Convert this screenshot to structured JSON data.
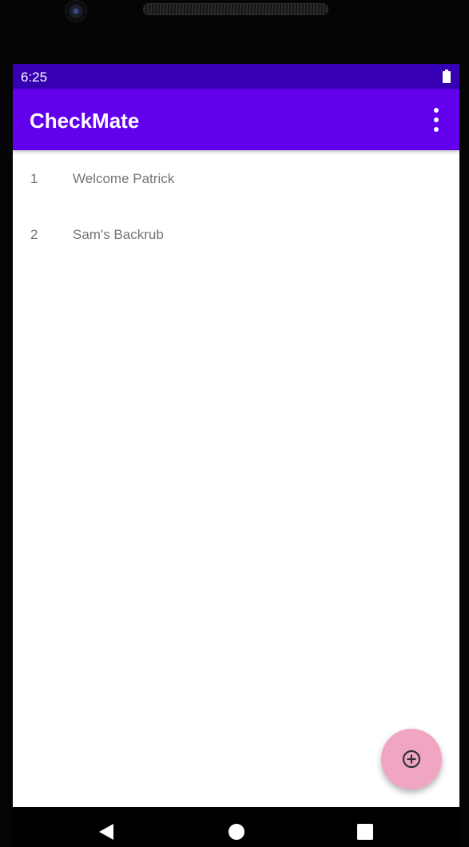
{
  "status_bar": {
    "time": "6:25",
    "battery_icon": "battery-full-icon"
  },
  "app_bar": {
    "title": "CheckMate",
    "menu_icon": "more-vert-icon"
  },
  "list": {
    "items": [
      {
        "number": "1",
        "label": "Welcome Patrick"
      },
      {
        "number": "2",
        "label": "Sam's Backrub"
      }
    ]
  },
  "fab": {
    "icon": "add-circle-icon",
    "color": "#f0a6c3"
  },
  "nav_bar": {
    "back_icon": "back-triangle-icon",
    "home_icon": "home-circle-icon",
    "recents_icon": "recents-square-icon"
  },
  "colors": {
    "status_bar": "#3700b3",
    "app_bar": "#6200ee",
    "list_text": "#757575"
  }
}
